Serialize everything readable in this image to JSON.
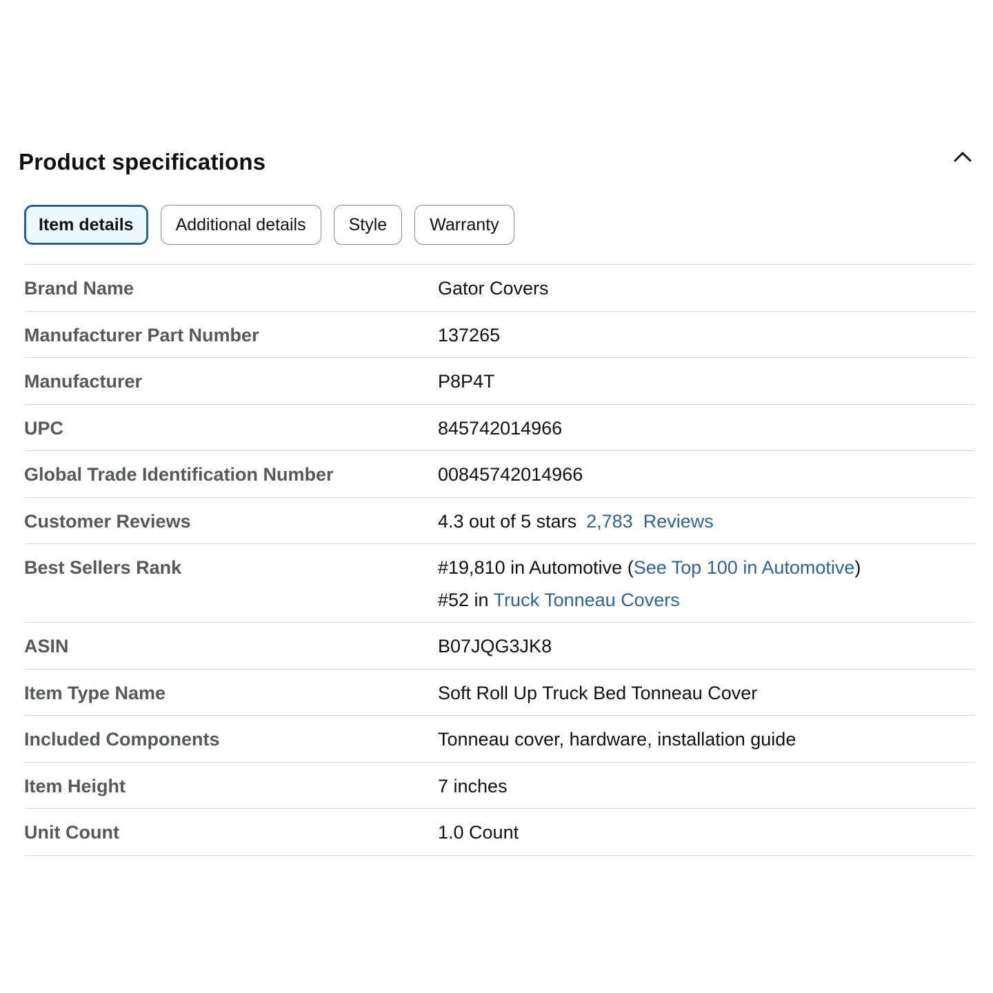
{
  "header": {
    "title": "Product specifications",
    "collapse_icon": "chevron-up-icon"
  },
  "tabs": [
    {
      "label": "Item details",
      "active": true
    },
    {
      "label": "Additional details",
      "active": false
    },
    {
      "label": "Style",
      "active": false
    },
    {
      "label": "Warranty",
      "active": false
    }
  ],
  "specs": {
    "brand_name": {
      "label": "Brand Name",
      "value": "Gator Covers"
    },
    "mpn": {
      "label": "Manufacturer Part Number",
      "value": "137265"
    },
    "manufacturer": {
      "label": "Manufacturer",
      "value": "P8P4T"
    },
    "upc": {
      "label": "UPC",
      "value": "845742014966"
    },
    "gtin": {
      "label": "Global Trade Identification Number",
      "value": "00845742014966"
    },
    "reviews": {
      "label": "Customer Reviews",
      "rating_text": "4.3 out of 5 stars",
      "count_link": "2,783  Reviews"
    },
    "rank": {
      "label": "Best Sellers Rank",
      "line1_prefix": "#19,810 in Automotive (",
      "line1_link": "See Top 100 in Automotive",
      "line1_suffix": ")",
      "line2_prefix": "#52 in ",
      "line2_link": "Truck Tonneau Covers"
    },
    "asin": {
      "label": "ASIN",
      "value": "B07JQG3JK8"
    },
    "item_type": {
      "label": "Item Type Name",
      "value": "Soft Roll Up Truck Bed Tonneau Cover"
    },
    "components": {
      "label": "Included Components",
      "value": "Tonneau cover, hardware, installation guide"
    },
    "height": {
      "label": "Item Height",
      "value": "7 inches"
    },
    "unit_count": {
      "label": "Unit Count",
      "value": "1.0 Count"
    }
  },
  "colors": {
    "link": "#2a6596",
    "label": "#565959",
    "active_tab_border": "#2b5f8e",
    "active_tab_bg": "#edf7ff",
    "divider": "#d5d9d9"
  }
}
